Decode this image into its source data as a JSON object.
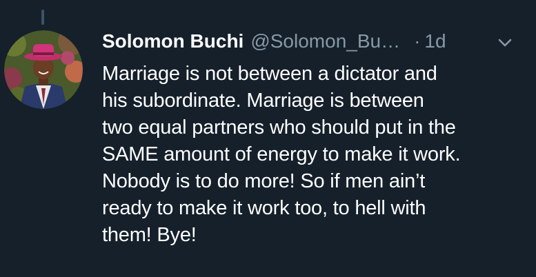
{
  "tweet": {
    "author_name": "Solomon Buchi",
    "handle": "@Solomon_Bu…",
    "separator": "·",
    "time": "1d",
    "caret_icon": "chevron-down-icon",
    "avatar_icon": "avatar-photo",
    "body_lines": [
      "Marriage is not between a dictator and",
      "his subordinate. Marriage is between",
      "two equal partners who should put in the",
      "SAME amount of energy to make it work.",
      "Nobody is to do more! So if men ain’t",
      "ready to make it work too, to hell with",
      "them! Bye!"
    ]
  },
  "colors": {
    "background": "#15202b",
    "text_primary": "#ffffff",
    "text_secondary": "#8899a6",
    "thread_line": "#3d5466"
  }
}
